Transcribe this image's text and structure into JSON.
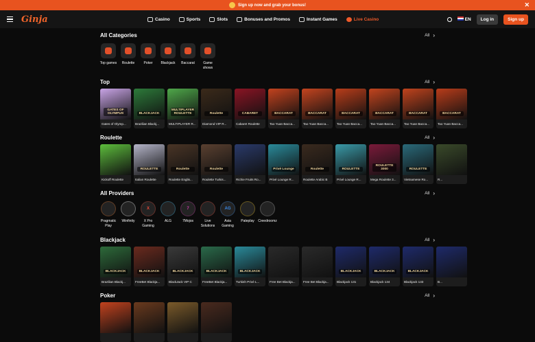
{
  "promo": {
    "text": "Sign up now and grab your bonus!"
  },
  "header": {
    "logo": "Ginja",
    "menu": [
      {
        "label": "Casino",
        "icon": "casino-icon"
      },
      {
        "label": "Sports",
        "icon": "sports-icon"
      },
      {
        "label": "Slots",
        "icon": "slots-icon"
      },
      {
        "label": "Bonuses and Promos",
        "icon": "gift-icon"
      },
      {
        "label": "Instant Games",
        "icon": "rocket-icon"
      },
      {
        "label": "Live Casino",
        "icon": "live-icon"
      }
    ],
    "language": "EN",
    "login": "Log in",
    "signup": "Sign up"
  },
  "sections": {
    "categories": {
      "title": "All Categories",
      "all": "All"
    },
    "top": {
      "title": "Top",
      "all": "All"
    },
    "roulette": {
      "title": "Roulette",
      "all": "All"
    },
    "providers": {
      "title": "All Providers",
      "all": "All"
    },
    "blackjack": {
      "title": "Blackjack",
      "all": "All"
    },
    "poker": {
      "title": "Poker",
      "all": "All"
    }
  },
  "categories": [
    "Top games",
    "Roulette",
    "Poker",
    "Blackjack",
    "Baccarat",
    "Game shows"
  ],
  "top_games": [
    {
      "name": "Gates of Olymp...",
      "tag": "GATES OF OLYMPUS",
      "color": "#c9a4e6"
    },
    {
      "name": "Brazilian Blackj...",
      "tag": "BLACKJACK",
      "color": "#2d7a3a"
    },
    {
      "name": "MULTIPLAYER R...",
      "tag": "MULTIPLAYER ROULETTE",
      "color": "#4fa84a"
    },
    {
      "name": "Diamond VIP R...",
      "tag": "Roulette",
      "color": "#3b2a1a"
    },
    {
      "name": "Cabaret Roulette",
      "tag": "CABARET",
      "color": "#8a1424"
    },
    {
      "name": "Tao Yuan Bacca...",
      "tag": "BACCARAT",
      "color": "#c2421e"
    },
    {
      "name": "Tao Yuan Bacca...",
      "tag": "BACCARAT",
      "color": "#c4441f"
    },
    {
      "name": "Tao Yuan Bacca...",
      "tag": "BACCARAT",
      "color": "#b83d1a"
    },
    {
      "name": "Tao Yuan Bacca...",
      "tag": "BACCARAT",
      "color": "#c2441e"
    },
    {
      "name": "Tao Yuan Bacca...",
      "tag": "BACCARAT",
      "color": "#c0431d"
    },
    {
      "name": "Tao Yuan Bacca...",
      "tag": "BACCARAT",
      "color": "#b83c1a"
    }
  ],
  "roulette_games": [
    {
      "name": "Kickoff Roulette",
      "tag": "",
      "color": "#5dbd3c"
    },
    {
      "name": "Italian Roulette",
      "tag": "ROULETTE",
      "color": "#b4b4c8"
    },
    {
      "name": "Roulette Englis...",
      "tag": "Roulette",
      "color": "#4a3526"
    },
    {
      "name": "Roulette Turkis...",
      "tag": "Roulette",
      "color": "#5a4030"
    },
    {
      "name": "Richie Fruits Ro...",
      "tag": "",
      "color": "#2a3a6a"
    },
    {
      "name": "Privé Lounge R...",
      "tag": "Privé Lounge",
      "color": "#2a8a9a"
    },
    {
      "name": "Roulette Arabic B",
      "tag": "Roulette",
      "color": "#3a2a1e"
    },
    {
      "name": "Privé Lounge R...",
      "tag": "ROULETTE",
      "color": "#3a9aa8"
    },
    {
      "name": "Mega Roulette 3...",
      "tag": "ROULETTE 3000",
      "color": "#7a1a3a"
    },
    {
      "name": "Vietnamese Ro...",
      "tag": "ROULETTE",
      "color": "#2a6a7a"
    },
    {
      "name": "R...",
      "tag": "",
      "color": "#3a4a2a"
    }
  ],
  "providers": [
    {
      "name": "Pragmatic Play",
      "mark": "",
      "color": "#e8762a"
    },
    {
      "name": "Winfinity",
      "mark": "",
      "color": "#ffffff"
    },
    {
      "name": "X Pro Gaming",
      "mark": "X",
      "color": "#e84a3a"
    },
    {
      "name": "ALG",
      "mark": "",
      "color": "#3ab4e8"
    },
    {
      "name": "7Mojos",
      "mark": "7",
      "color": "#c83aa8"
    },
    {
      "name": "Live Solutions",
      "mark": "",
      "color": "#e84a3a"
    },
    {
      "name": "Asia Gaming",
      "mark": "AG",
      "color": "#3a8ae8"
    },
    {
      "name": "Pateplay",
      "mark": "",
      "color": "#f2c41a"
    },
    {
      "name": "Creedroomz",
      "mark": "",
      "color": "#aaaaaa"
    }
  ],
  "blackjack_games": [
    {
      "name": "Brazilian Blackj...",
      "tag": "BLACKJACK",
      "color": "#2d6a3a"
    },
    {
      "name": "FreeBet Blackja...",
      "tag": "BLACKJACK",
      "color": "#6a2a1e"
    },
    {
      "name": "BlackJack VIP C",
      "tag": "BLACKJACK",
      "color": "#3a3a3a"
    },
    {
      "name": "FreeBet Blackja...",
      "tag": "BLACKJACK",
      "color": "#2a6a4a"
    },
    {
      "name": "Turkish Privé L...",
      "tag": "BLACKJACK",
      "color": "#2a8a9a"
    },
    {
      "name": "Free Bet Blackja...",
      "tag": "",
      "color": "#2a2a2a"
    },
    {
      "name": "Free Bet Blackja...",
      "tag": "",
      "color": "#2a2a2a"
    },
    {
      "name": "Blackjack 131",
      "tag": "BLACKJACK",
      "color": "#1e2a6a"
    },
    {
      "name": "Blackjack 134",
      "tag": "BLACKJACK",
      "color": "#1e2a6a"
    },
    {
      "name": "Blackjack 133",
      "tag": "BLACKJACK",
      "color": "#1e2a6a"
    },
    {
      "name": "B...",
      "tag": "",
      "color": "#1e2a6a"
    }
  ],
  "poker_games": [
    {
      "name": "",
      "tag": "",
      "color": "#c2421e"
    },
    {
      "name": "",
      "tag": "",
      "color": "#6a3a1e"
    },
    {
      "name": "",
      "tag": "",
      "color": "#7a5a2a"
    },
    {
      "name": "",
      "tag": "",
      "color": "#4a2a1e"
    }
  ]
}
